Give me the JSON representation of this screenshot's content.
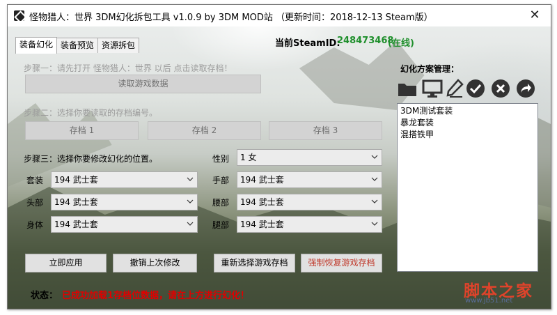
{
  "window": {
    "title": "怪物猎人：世界 3DM幻化拆包工具 v1.0.9 by 3DM MOD站  （更新时间：2018-12-13 Steam版）",
    "close_glyph": "✕"
  },
  "tabs": [
    {
      "label": "装备幻化",
      "active": true
    },
    {
      "label": "装备预览",
      "active": false
    },
    {
      "label": "资源拆包",
      "active": false
    }
  ],
  "steam": {
    "label": "当前SteamID:",
    "id": "248473468",
    "status": "(在线)",
    "color": "#1f8f2c"
  },
  "step1": {
    "text": "步骤一：请先打开 怪物猎人：世界 以后 点击读取存档！",
    "button": "读取游戏数据"
  },
  "step2": {
    "text": "步骤二：选择你要读取的存档编号。",
    "slots": [
      "存档 1",
      "存档 2",
      "存档 3"
    ]
  },
  "step3": {
    "text": "步骤三：选择你要修改幻化的位置。",
    "fields": {
      "gender": {
        "label": "性别",
        "value": "1 女"
      },
      "set": {
        "label": "套装",
        "value": "194 武士套"
      },
      "hand": {
        "label": "手部",
        "value": "194 武士套"
      },
      "head": {
        "label": "头部",
        "value": "194 武士套"
      },
      "waist": {
        "label": "腰部",
        "value": "194 武士套"
      },
      "body": {
        "label": "身体",
        "value": "194 武士套"
      },
      "leg": {
        "label": "腿部",
        "value": "194 武士套"
      }
    }
  },
  "actions": {
    "apply": "立即应用",
    "undo": "撤销上次修改",
    "reselect": "重新选择游戏存档",
    "force_restore": "强制恢复游戏存档",
    "danger_color": "#c0392b"
  },
  "status": {
    "label": "状态：",
    "text": "已成功加载1存档位数据，请在上方进行幻化！",
    "color": "#e00000"
  },
  "plans": {
    "title": "幻化方案管理：",
    "toolbar": [
      "folder-icon",
      "monitor-icon",
      "pen-icon",
      "check-icon",
      "delete-icon",
      "share-icon"
    ],
    "items": [
      "3DM测试套装",
      "暴龙套装",
      "混搭铁甲"
    ]
  },
  "watermark": {
    "text": "脚本之家",
    "url": "www.jb51.net"
  }
}
